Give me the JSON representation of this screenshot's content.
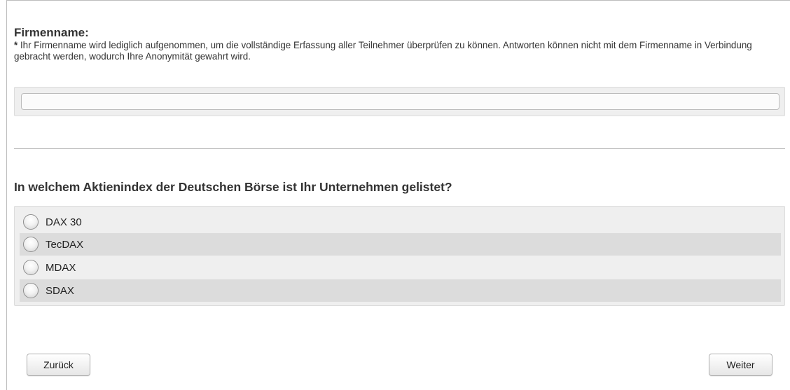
{
  "question1": {
    "title": "Firmenname:",
    "note_star": "*",
    "note_text": " Ihr Firmenname wird lediglich aufgenommen, um die vollständige Erfassung aller Teilnehmer überprüfen zu können. Antworten können nicht mit dem Firmenname in Verbindung gebracht werden, wodurch Ihre Anonymität gewahrt wird.",
    "input_value": "",
    "input_placeholder": ""
  },
  "question2": {
    "title": "In welchem Aktienindex der Deutschen Börse ist Ihr Unternehmen gelistet?",
    "options": [
      {
        "label": "DAX 30",
        "selected": false
      },
      {
        "label": "TecDAX",
        "selected": false
      },
      {
        "label": "MDAX",
        "selected": false
      },
      {
        "label": "SDAX",
        "selected": false
      }
    ]
  },
  "navigation": {
    "back_label": "Zurück",
    "next_label": "Weiter"
  }
}
